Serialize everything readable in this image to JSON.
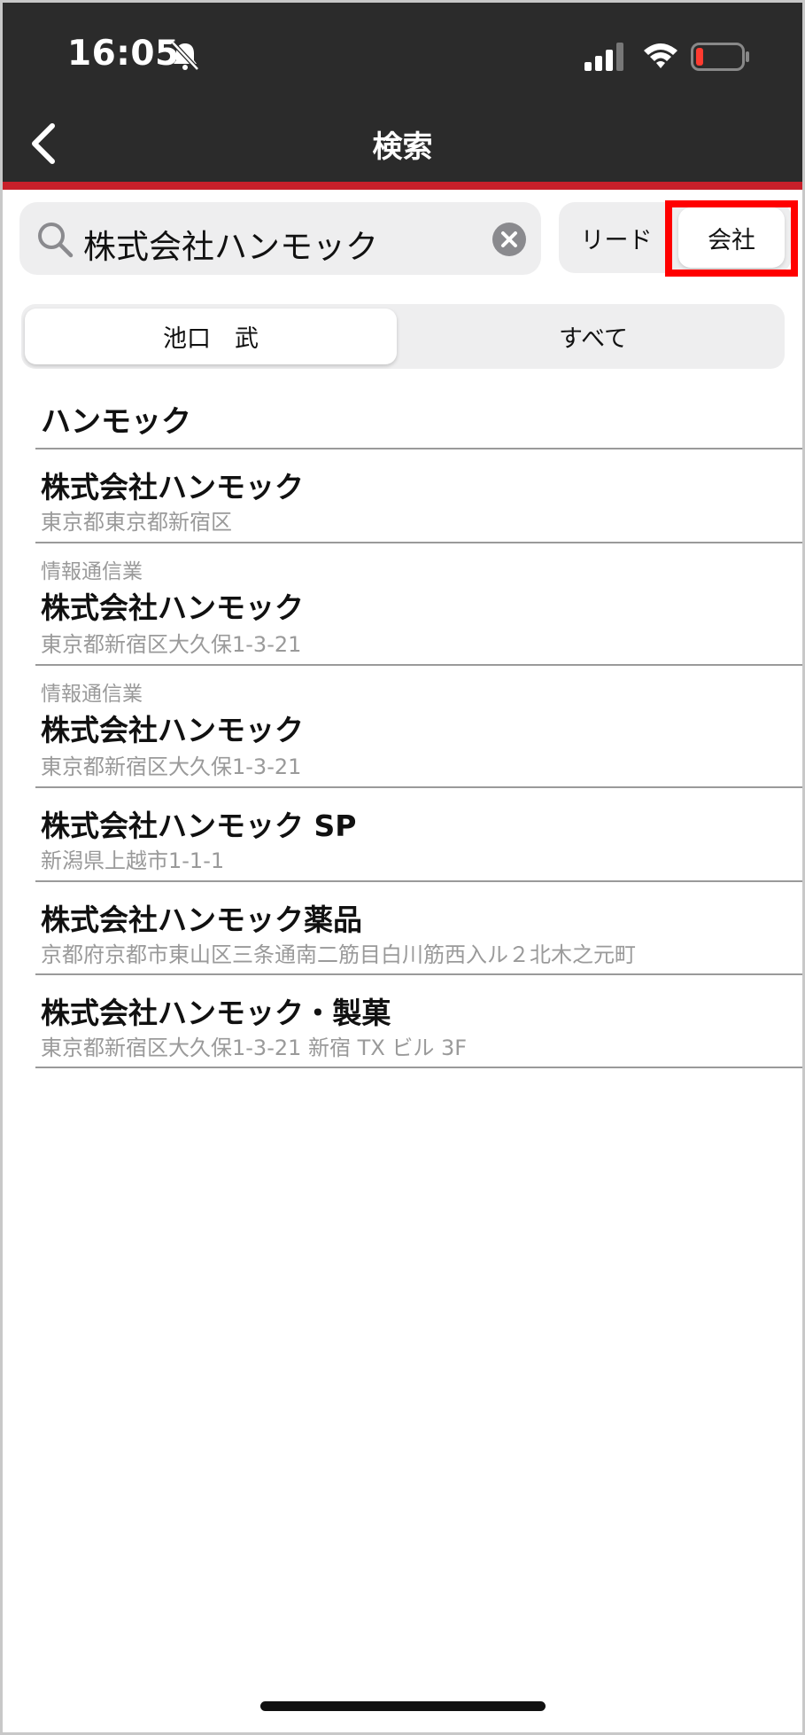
{
  "status_bar": {
    "time": "16:05",
    "icons": [
      "bell-slash-icon",
      "cellular-signal-icon",
      "wifi-icon",
      "battery-low-icon"
    ],
    "battery_color": "#ff3b30"
  },
  "nav": {
    "title": "検索",
    "back_icon": "chevron-left-icon"
  },
  "search": {
    "value": "株式会社ハンモック",
    "search_icon": "magnifier-icon",
    "clear_icon": "clear-circle-icon"
  },
  "type_toggle": {
    "lead_label": "リード",
    "company_label": "会社",
    "selected": "会社",
    "highlight_color": "#ff0000"
  },
  "owner_filter": {
    "selected_label": "池口　武",
    "other_label": "すべて"
  },
  "results": {
    "section_title": "ハンモック",
    "items": [
      {
        "category": "",
        "name": "株式会社ハンモック",
        "address": "東京都東京都新宿区"
      },
      {
        "category": "情報通信業",
        "name": "株式会社ハンモック",
        "address": "東京都新宿区大久保1-3-21"
      },
      {
        "category": "情報通信業",
        "name": "株式会社ハンモック",
        "address": "東京都新宿区大久保1-3-21"
      },
      {
        "category": "",
        "name": "株式会社ハンモック SP",
        "address": "新潟県上越市1-1-1"
      },
      {
        "category": "",
        "name": "株式会社ハンモック薬品",
        "address": "京都府京都市東山区三条通南二筋目白川筋西入ル２北木之元町"
      },
      {
        "category": "",
        "name": "株式会社ハンモック・製菓",
        "address": "東京都新宿区大久保1-3-21 新宿 TX ビル 3F"
      }
    ]
  },
  "colors": {
    "header_bg": "#2b2b2b",
    "accent_red": "#c8202a",
    "secondary_text": "#9a9a9a"
  }
}
